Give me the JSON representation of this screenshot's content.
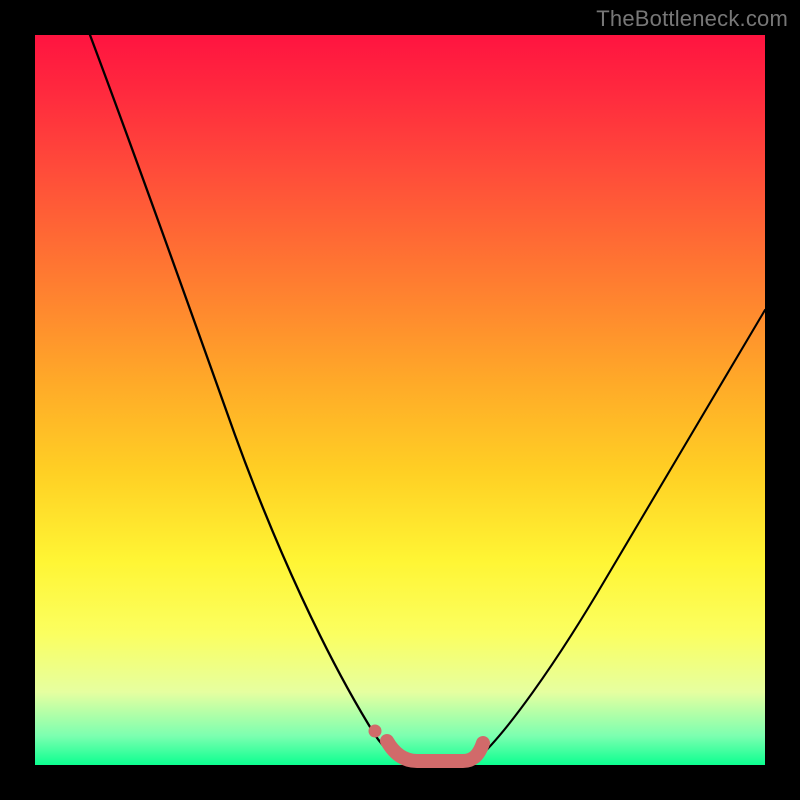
{
  "watermark": "TheBottleneck.com",
  "chart_data": {
    "type": "line",
    "title": "",
    "xlabel": "",
    "ylabel": "",
    "xlim": [
      0,
      100
    ],
    "ylim": [
      0,
      100
    ],
    "grid": false,
    "legend": false,
    "annotations": [],
    "series": [
      {
        "name": "left-curve",
        "color": "#000000",
        "x": [
          8,
          12,
          16,
          20,
          24,
          28,
          32,
          36,
          40,
          44,
          48,
          50
        ],
        "values": [
          100,
          88,
          76,
          65,
          54,
          43,
          33,
          24,
          16,
          9,
          3,
          1
        ]
      },
      {
        "name": "right-curve",
        "color": "#000000",
        "x": [
          60,
          64,
          68,
          72,
          76,
          80,
          84,
          88,
          92,
          96,
          100
        ],
        "values": [
          1,
          5,
          10,
          16,
          23,
          30,
          37,
          44,
          51,
          58,
          64
        ]
      },
      {
        "name": "bottom-band",
        "color": "#d16a6a",
        "x": [
          48,
          50,
          52,
          54,
          56,
          58,
          60
        ],
        "values": [
          3,
          1,
          1,
          1,
          1,
          1,
          3
        ]
      },
      {
        "name": "bottom-dot",
        "color": "#d16a6a",
        "x": [
          45
        ],
        "values": [
          5
        ]
      }
    ]
  }
}
